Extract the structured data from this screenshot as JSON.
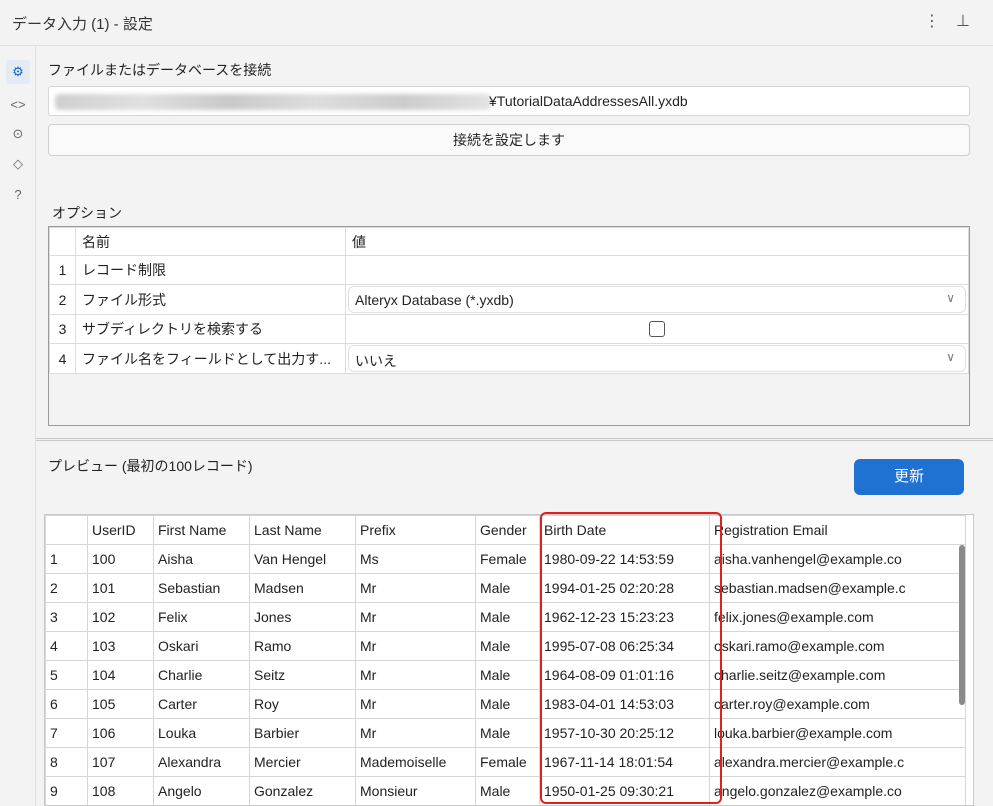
{
  "titlebar": {
    "title": "データ入力 (1) - 設定",
    "kebab": "⋮",
    "pin": "⊥"
  },
  "siderail": {
    "icons": [
      "⚙",
      "<>",
      "⊙",
      "◇",
      "?"
    ]
  },
  "connect": {
    "heading": "ファイルまたはデータベースを接続",
    "path_visible": "¥TutorialDataAddressesAll.yxdb",
    "button": "接続を設定します"
  },
  "options": {
    "heading": "オプション",
    "columns": [
      "名前",
      "値"
    ],
    "rows": [
      {
        "n": "1",
        "name": "レコード制限",
        "value": ""
      },
      {
        "n": "2",
        "name": "ファイル形式",
        "value": "Alteryx Database (*.yxdb)"
      },
      {
        "n": "3",
        "name": "サブディレクトリを検索する",
        "value": ""
      },
      {
        "n": "4",
        "name": "ファイル名をフィールドとして出力す...",
        "value": "いいえ"
      }
    ]
  },
  "preview": {
    "heading": "プレビュー (最初の100レコード)",
    "refresh": "更新",
    "columns": [
      "",
      "UserID",
      "First Name",
      "Last Name",
      "Prefix",
      "Gender",
      "Birth Date",
      "Registration Email"
    ],
    "rows": [
      [
        "1",
        "100",
        "Aisha",
        "Van Hengel",
        "Ms",
        "Female",
        "1980-09-22 14:53:59",
        "aisha.vanhengel@example.co"
      ],
      [
        "2",
        "101",
        "Sebastian",
        "Madsen",
        "Mr",
        "Male",
        "1994-01-25 02:20:28",
        "sebastian.madsen@example.c"
      ],
      [
        "3",
        "102",
        "Felix",
        "Jones",
        "Mr",
        "Male",
        "1962-12-23 15:23:23",
        "felix.jones@example.com"
      ],
      [
        "4",
        "103",
        "Oskari",
        "Ramo",
        "Mr",
        "Male",
        "1995-07-08 06:25:34",
        "oskari.ramo@example.com"
      ],
      [
        "5",
        "104",
        "Charlie",
        "Seitz",
        "Mr",
        "Male",
        "1964-08-09 01:01:16",
        "charlie.seitz@example.com"
      ],
      [
        "6",
        "105",
        "Carter",
        "Roy",
        "Mr",
        "Male",
        "1983-04-01 14:53:03",
        "carter.roy@example.com"
      ],
      [
        "7",
        "106",
        "Louka",
        "Barbier",
        "Mr",
        "Male",
        "1957-10-30 20:25:12",
        "louka.barbier@example.com"
      ],
      [
        "8",
        "107",
        "Alexandra",
        "Mercier",
        "Mademoiselle",
        "Female",
        "1967-11-14 18:01:54",
        "alexandra.mercier@example.c"
      ],
      [
        "9",
        "108",
        "Angelo",
        "Gonzalez",
        "Monsieur",
        "Male",
        "1950-01-25 09:30:21",
        "angelo.gonzalez@example.co"
      ]
    ]
  },
  "colors": {
    "accent": "#1f72d2",
    "highlight": "#e02020"
  }
}
